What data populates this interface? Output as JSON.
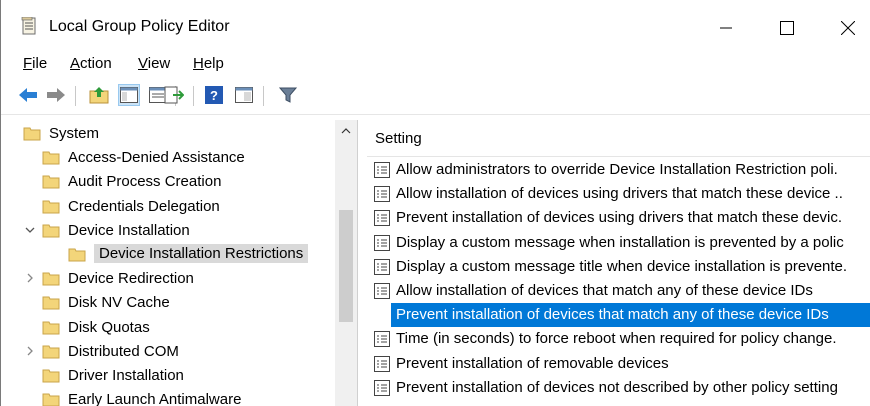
{
  "window": {
    "title": "Local Group Policy Editor",
    "controls": {
      "minimize": "—",
      "maximize": "☐",
      "close": "✕"
    }
  },
  "menu": {
    "items": [
      {
        "label": "File",
        "key": "F"
      },
      {
        "label": "Action",
        "key": "A"
      },
      {
        "label": "View",
        "key": "V"
      },
      {
        "label": "Help",
        "key": "H"
      }
    ]
  },
  "toolbar": {
    "icons": [
      "back-icon",
      "forward-icon",
      "up-folder-icon",
      "show-hide-tree-icon",
      "export-list-icon",
      "help-icon",
      "properties-icon",
      "filter-icon"
    ]
  },
  "tree": {
    "items": [
      {
        "label": "System",
        "level": 0,
        "expander": "none"
      },
      {
        "label": "Access-Denied Assistance",
        "level": 1,
        "expander": "none"
      },
      {
        "label": "Audit Process Creation",
        "level": 1,
        "expander": "none"
      },
      {
        "label": "Credentials Delegation",
        "level": 1,
        "expander": "none"
      },
      {
        "label": "Device Installation",
        "level": 1,
        "expander": "expanded"
      },
      {
        "label": "Device Installation Restrictions",
        "level": 2,
        "expander": "none",
        "selected": true
      },
      {
        "label": "Device Redirection",
        "level": 1,
        "expander": "collapsed"
      },
      {
        "label": "Disk NV Cache",
        "level": 1,
        "expander": "none"
      },
      {
        "label": "Disk Quotas",
        "level": 1,
        "expander": "none"
      },
      {
        "label": "Distributed COM",
        "level": 1,
        "expander": "collapsed"
      },
      {
        "label": "Driver Installation",
        "level": 1,
        "expander": "none"
      },
      {
        "label": "Early Launch Antimalware",
        "level": 1,
        "expander": "none"
      }
    ]
  },
  "settings": {
    "column_header": "Setting",
    "rows": [
      {
        "text": "Allow administrators to override Device Installation Restriction poli."
      },
      {
        "text": "Allow installation of devices using drivers that match these device .."
      },
      {
        "text": "Prevent installation of devices using drivers that match these devic."
      },
      {
        "text": "Display a custom message when installation is prevented by a polic"
      },
      {
        "text": "Display a custom message title when device installation is prevente."
      },
      {
        "text": "Allow installation of devices that match any of these device IDs"
      },
      {
        "text": "Prevent installation of devices that match any of these device IDs",
        "selected": true
      },
      {
        "text": "Time (in seconds) to force reboot when required for policy change."
      },
      {
        "text": "Prevent installation of removable devices"
      },
      {
        "text": "Prevent installation of devices not described by other policy setting"
      }
    ]
  },
  "colors": {
    "selection": "#0078d7",
    "tree_selected": "#d9d9d9",
    "folder": "#f3d57a"
  }
}
